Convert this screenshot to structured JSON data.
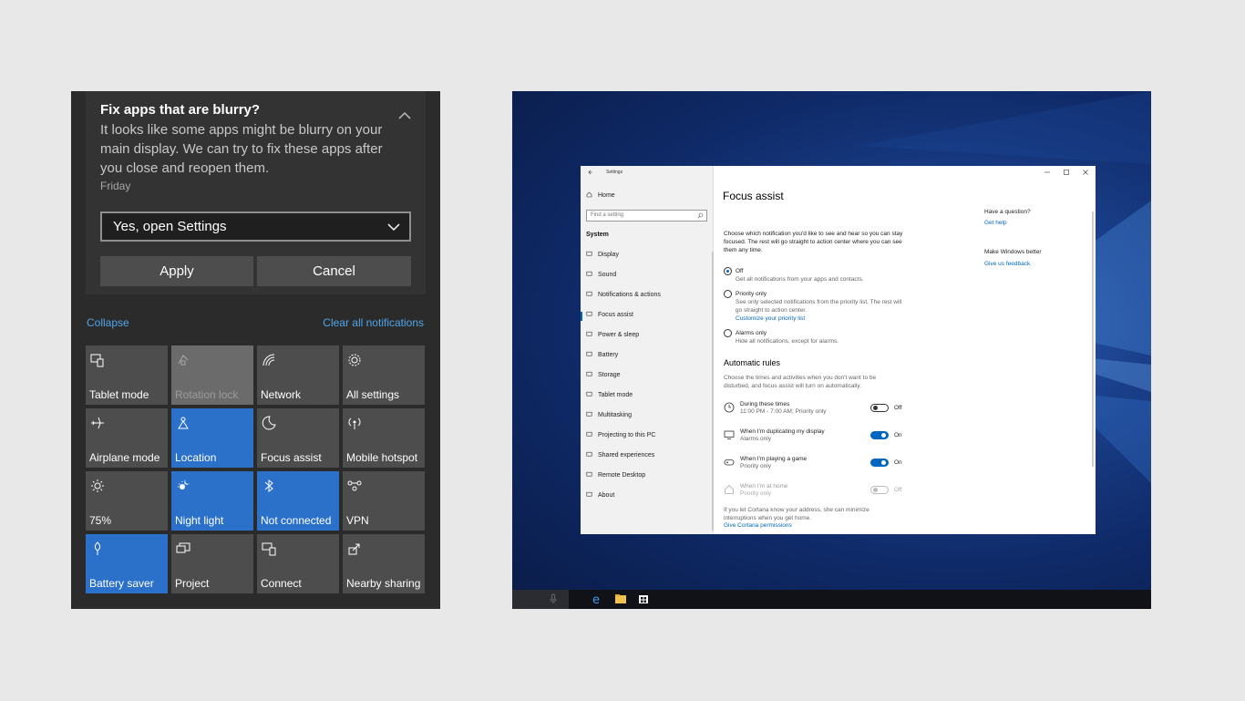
{
  "action_center": {
    "notification": {
      "title": "Fix apps that are blurry?",
      "body": "It looks like some apps might be blurry on your main display. We can try to fix these apps after you close and reopen them.",
      "time": "Friday",
      "select_value": "Yes, open Settings",
      "apply_label": "Apply",
      "cancel_label": "Cancel"
    },
    "collapse_label": "Collapse",
    "clear_label": "Clear all notifications",
    "tiles": [
      {
        "label": "Tablet mode",
        "icon": "tablet-mode-icon",
        "state": "off"
      },
      {
        "label": "Rotation lock",
        "icon": "rotation-lock-icon",
        "state": "disabled"
      },
      {
        "label": "Network",
        "icon": "network-icon",
        "state": "off"
      },
      {
        "label": "All settings",
        "icon": "gear-icon",
        "state": "off"
      },
      {
        "label": "Airplane mode",
        "icon": "airplane-icon",
        "state": "off"
      },
      {
        "label": "Location",
        "icon": "location-icon",
        "state": "on"
      },
      {
        "label": "Focus assist",
        "icon": "moon-icon",
        "state": "off"
      },
      {
        "label": "Mobile hotspot",
        "icon": "hotspot-icon",
        "state": "off"
      },
      {
        "label": "75%",
        "icon": "brightness-icon",
        "state": "off"
      },
      {
        "label": "Night light",
        "icon": "night-light-icon",
        "state": "on"
      },
      {
        "label": "Not connected",
        "icon": "bluetooth-icon",
        "state": "on"
      },
      {
        "label": "VPN",
        "icon": "vpn-icon",
        "state": "off"
      },
      {
        "label": "Battery saver",
        "icon": "battery-saver-icon",
        "state": "on"
      },
      {
        "label": "Project",
        "icon": "project-icon",
        "state": "off"
      },
      {
        "label": "Connect",
        "icon": "connect-icon",
        "state": "off"
      },
      {
        "label": "Nearby sharing",
        "icon": "nearby-sharing-icon",
        "state": "off"
      }
    ]
  },
  "settings": {
    "window_title": "Settings",
    "sidebar": {
      "home": "Home",
      "search_placeholder": "Find a setting",
      "section": "System",
      "items": [
        "Display",
        "Sound",
        "Notifications & actions",
        "Focus assist",
        "Power & sleep",
        "Battery",
        "Storage",
        "Tablet mode",
        "Multitasking",
        "Projecting to this PC",
        "Shared experiences",
        "Remote Desktop",
        "About"
      ]
    },
    "page_title": "Focus assist",
    "intro": "Choose which notification you'd like to see and hear so you can stay focused. The rest will go straight to action center where you can see them any time.",
    "options": [
      {
        "label": "Off",
        "desc": "Get all notifications from your apps and contacts.",
        "selected": true
      },
      {
        "label": "Priority only",
        "desc": "See only selected notifications from the priority list. The rest will go straight to action center.",
        "link": "Customize your priority list",
        "selected": false
      },
      {
        "label": "Alarms only",
        "desc": "Hide all notifications, except for alarms.",
        "selected": false
      }
    ],
    "rules_heading": "Automatic rules",
    "rules_intro": "Choose the times and activities when you don't want to be disturbed, and focus assist will turn on automatically.",
    "rules": [
      {
        "title": "During these times",
        "sub": "11:00 PM - 7:00 AM; Priority only",
        "state": "Off"
      },
      {
        "title": "When I'm duplicating my display",
        "sub": "Alarms only",
        "state": "On"
      },
      {
        "title": "When I'm playing a game",
        "sub": "Priority only",
        "state": "On"
      },
      {
        "title": "When I'm at home",
        "sub": "Priority only",
        "state": "Off"
      }
    ],
    "cortana_note": "If you let Cortana know your address, she can minimize interruptions when you get home.",
    "cortana_link": "Give Cortana permissions",
    "right_panel": {
      "question": "Have a question?",
      "help_link": "Get help",
      "better": "Make Windows better",
      "feedback_link": "Give us feedback"
    }
  }
}
